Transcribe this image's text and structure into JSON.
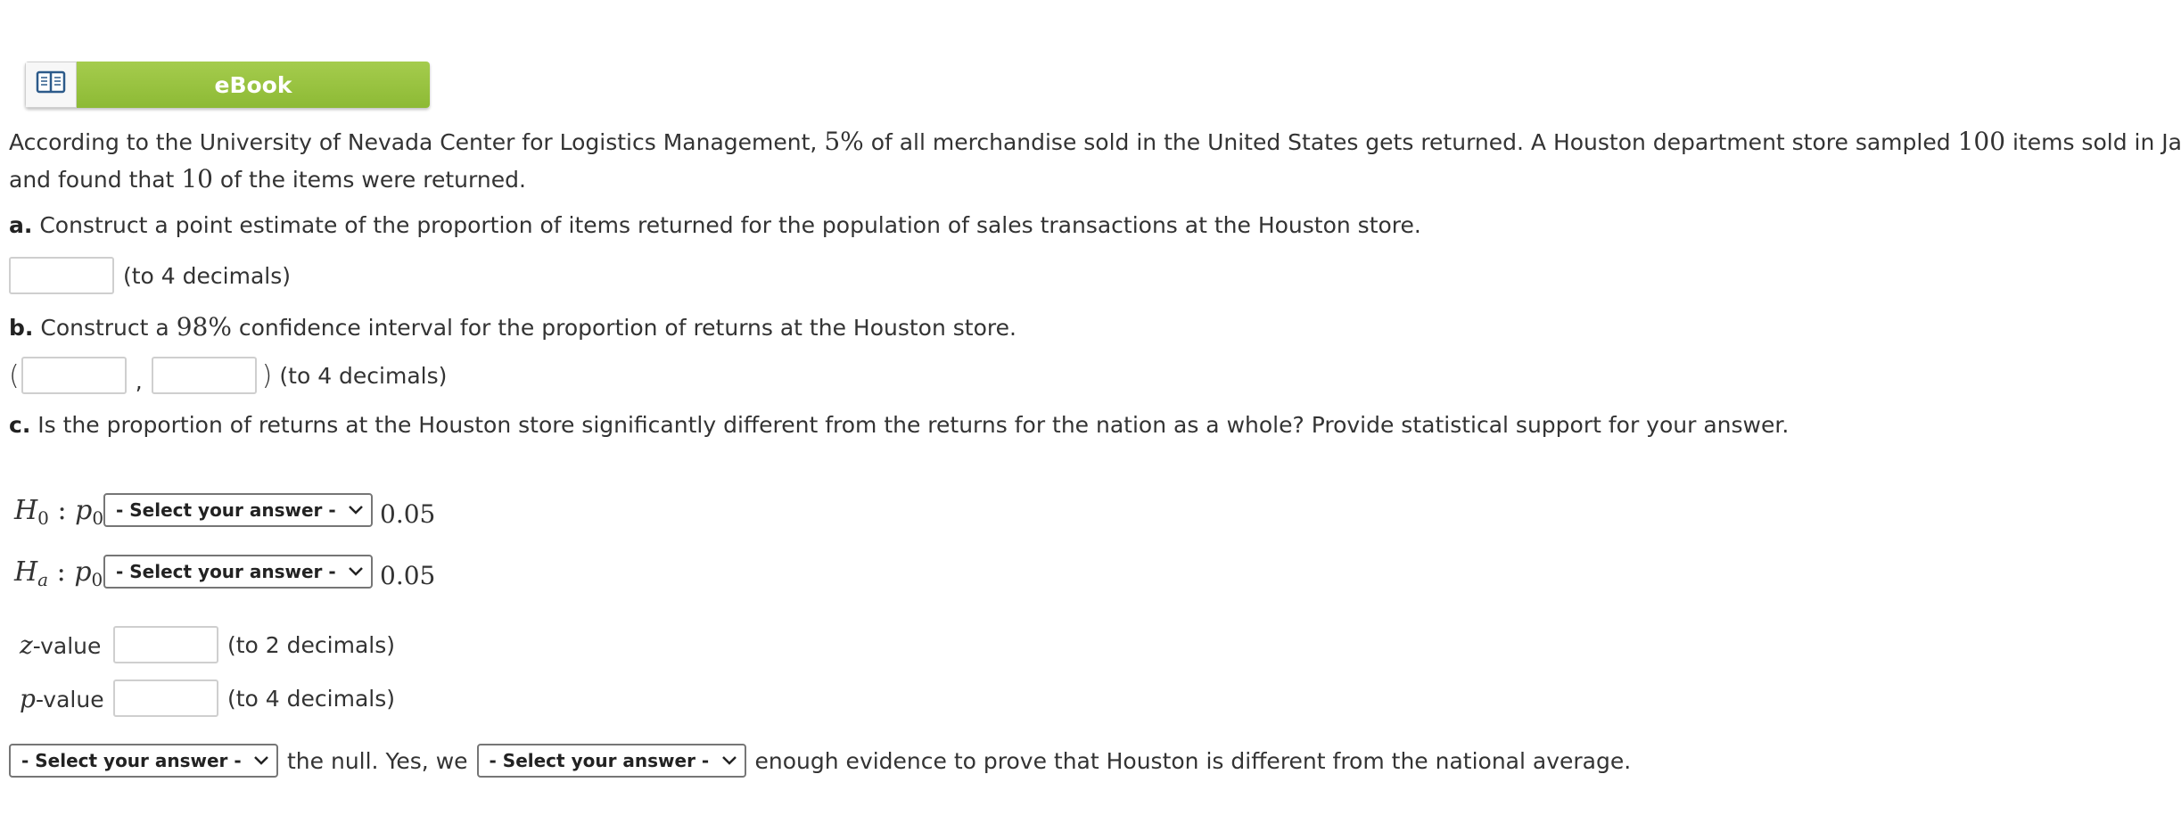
{
  "ebook": {
    "label": "eBook",
    "icon": "book-icon"
  },
  "problem": {
    "intro_1": "According to the University of Nevada Center for Logistics Management,",
    "pct": "5%",
    "intro_2": "of all merchandise sold in the United States gets returned. A Houston department store sampled",
    "n": "100",
    "intro_3": "items sold in January",
    "intro_4": "and found that",
    "x": "10",
    "intro_5": "of the items were returned."
  },
  "part_a": {
    "letter": "a.",
    "question": "Construct a point estimate of the proportion of items returned for the population of sales transactions at the Houston store.",
    "hint": "(to 4 decimals)"
  },
  "part_b": {
    "letter": "b.",
    "question_pre": "Construct a",
    "conf": "98%",
    "question_post": "confidence interval for the proportion of returns at the Houston store.",
    "open": "(",
    "comma": ",",
    "close": ")",
    "hint": "(to 4 decimals)"
  },
  "part_c": {
    "letter": "c.",
    "question": "Is the proportion of returns at the Houston store significantly different from the returns for the nation as a whole? Provide statistical support for your answer.",
    "h0": {
      "H": "H",
      "sub": "0",
      "colon": ":",
      "p": "p",
      "psub": "0",
      "select": "- Select your answer -",
      "value": "0.05"
    },
    "ha": {
      "H": "H",
      "sub": "a",
      "colon": ":",
      "p": "p",
      "psub": "0",
      "select": "- Select your answer -",
      "value": "0.05"
    },
    "z": {
      "var": "z",
      "label": "-value",
      "hint": "(to 2 decimals)"
    },
    "pv": {
      "var": "p",
      "label": "-value",
      "hint": "(to 4 decimals)"
    },
    "conclusion": {
      "select1": "- Select your answer -",
      "mid": "the null. Yes, we",
      "select2": "- Select your answer -",
      "end": "enough evidence to prove that Houston is different from the national average."
    }
  }
}
